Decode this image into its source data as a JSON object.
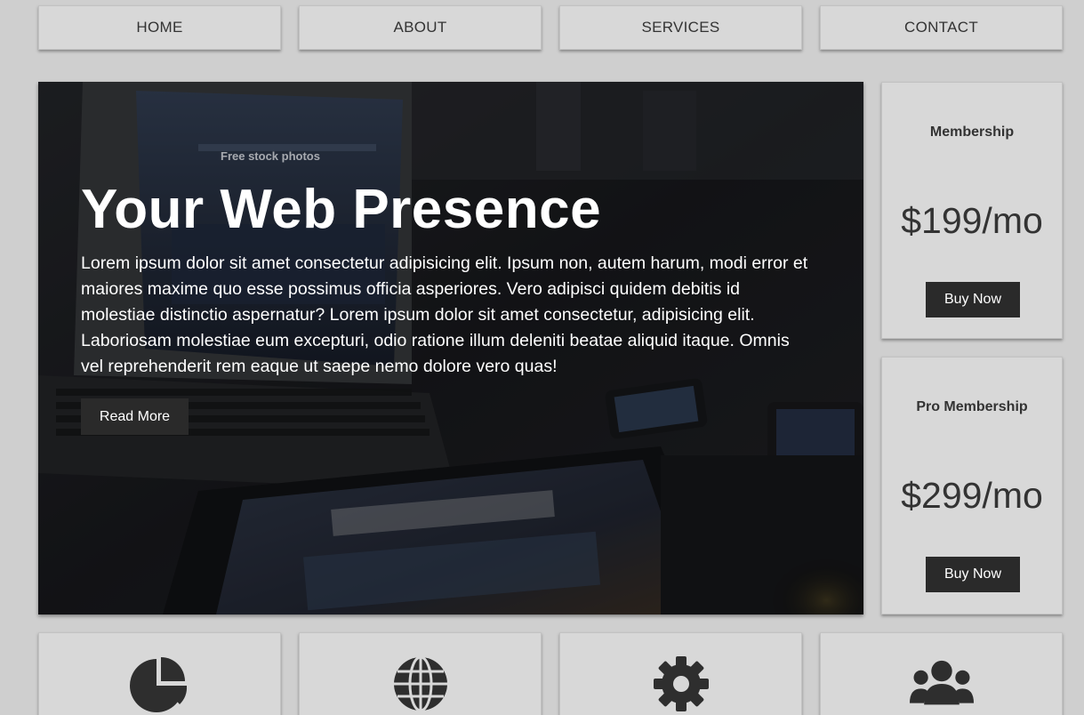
{
  "nav": {
    "items": [
      {
        "label": "HOME"
      },
      {
        "label": "ABOUT"
      },
      {
        "label": "SERVICES"
      },
      {
        "label": "CONTACT"
      }
    ]
  },
  "hero": {
    "title": "Your Web Presence",
    "text": "Lorem ipsum dolor sit amet consectetur adipisicing elit. Ipsum non, autem harum, modi error et maiores maxime quo esse possimus officia asperiores. Vero adipisci quidem debitis id molestiae distinctio aspernatur? Lorem ipsum dolor sit amet consectetur, adipisicing elit. Laboriosam molestiae eum excepturi, odio ratione illum deleniti beatae aliquid itaque. Omnis vel reprehenderit rem eaque ut saepe nemo dolore vero quas!",
    "button_label": "Read More",
    "screen_text": "Free stock photos"
  },
  "pricing": [
    {
      "name": "Membership",
      "price": "$199/mo",
      "button_label": "Buy Now"
    },
    {
      "name": "Pro Membership",
      "price": "$299/mo",
      "button_label": "Buy Now"
    }
  ],
  "features": [
    {
      "icon": "pie-chart-icon"
    },
    {
      "icon": "globe-icon"
    },
    {
      "icon": "gear-icon"
    },
    {
      "icon": "users-icon"
    }
  ],
  "colors": {
    "page_bg": "#cfcfcf",
    "box_bg": "#d8d8d8",
    "button_bg": "#2a2a2a",
    "text": "#333333",
    "hero_text": "#ffffff"
  }
}
